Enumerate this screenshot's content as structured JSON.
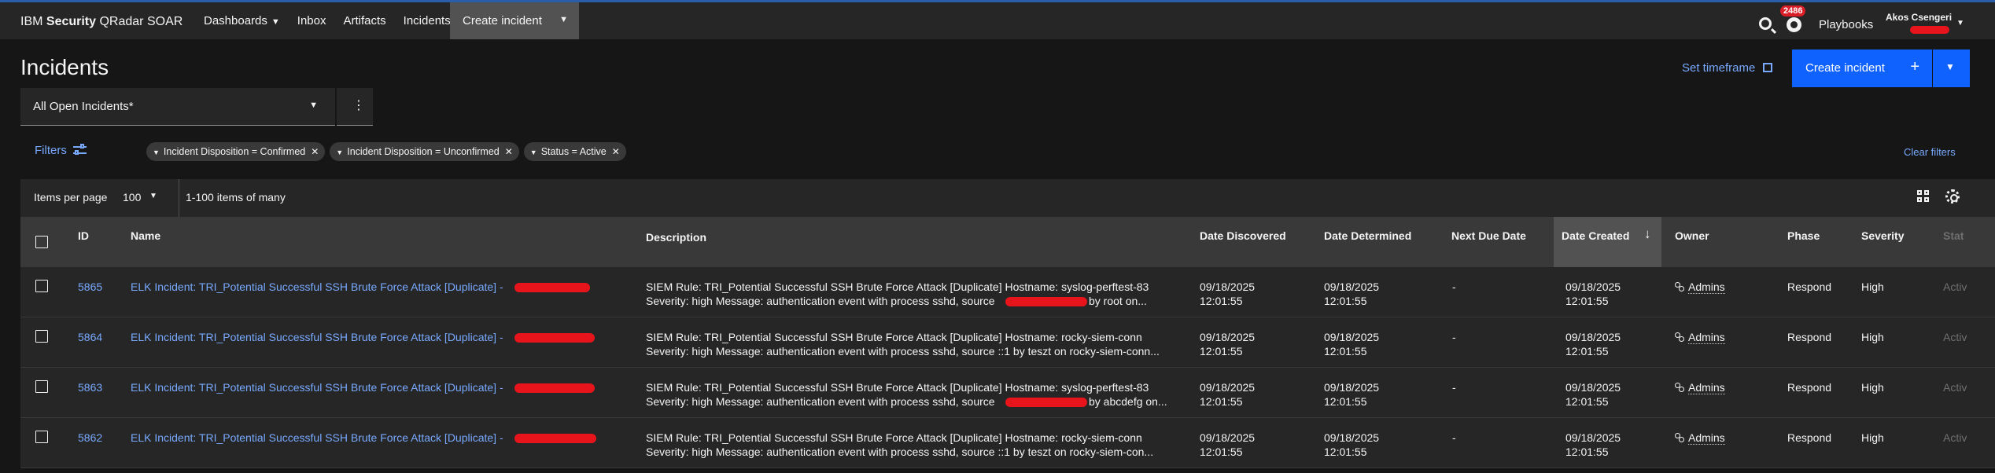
{
  "header": {
    "brand_prefix": "IBM ",
    "brand_bold": "Security",
    "brand_suffix": " QRadar SOAR",
    "nav": [
      "Dashboards",
      "Inbox",
      "Artifacts",
      "Incidents"
    ],
    "create_incident": "Create incident",
    "notification_count": "2486",
    "playbooks": "Playbooks",
    "user_name": "Akos Csengeri"
  },
  "page": {
    "title": "Incidents",
    "set_timeframe": "Set timeframe",
    "create_button": "Create incident"
  },
  "view": {
    "selected": "All Open Incidents*"
  },
  "filters": {
    "label": "Filters",
    "tags": [
      "Incident Disposition = Confirmed",
      "Incident Disposition = Unconfirmed",
      "Status = Active"
    ],
    "clear": "Clear filters"
  },
  "toolbar": {
    "items_per_page_label": "Items per page",
    "items_per_page_value": "100",
    "range": "1-100 items of many"
  },
  "table": {
    "columns": {
      "id": "ID",
      "name": "Name",
      "description": "Description",
      "date_discovered": "Date Discovered",
      "date_determined": "Date Determined",
      "next_due": "Next Due Date",
      "date_created": "Date Created",
      "owner": "Owner",
      "phase": "Phase",
      "severity": "Severity",
      "status": "Stat"
    },
    "rows": [
      {
        "id": "5865",
        "name": "ELK Incident: TRI_Potential Successful SSH Brute Force Attack [Duplicate] -",
        "desc1": "SIEM Rule: TRI_Potential Successful SSH Brute Force Attack [Duplicate] Hostname: syslog-perftest-83",
        "desc2a": "Severity: high Message: authentication event with process sshd, source",
        "desc2b": "by root on...",
        "discovered_date": "09/18/2025",
        "discovered_time": "12:01:55",
        "determined_date": "09/18/2025",
        "determined_time": "12:01:55",
        "next_due": "-",
        "created_date": "09/18/2025",
        "created_time": "12:01:55",
        "owner": "Admins",
        "phase": "Respond",
        "severity": "High",
        "status": "Activ"
      },
      {
        "id": "5864",
        "name": "ELK Incident: TRI_Potential Successful SSH Brute Force Attack [Duplicate] -",
        "desc1": "SIEM Rule: TRI_Potential Successful SSH Brute Force Attack [Duplicate] Hostname: rocky-siem-conn",
        "desc2a": "Severity: high Message: authentication event with process sshd, source ::1 by teszt on rocky-siem-conn...",
        "desc2b": "",
        "discovered_date": "09/18/2025",
        "discovered_time": "12:01:55",
        "determined_date": "09/18/2025",
        "determined_time": "12:01:55",
        "next_due": "-",
        "created_date": "09/18/2025",
        "created_time": "12:01:55",
        "owner": "Admins",
        "phase": "Respond",
        "severity": "High",
        "status": "Activ"
      },
      {
        "id": "5863",
        "name": "ELK Incident: TRI_Potential Successful SSH Brute Force Attack [Duplicate] -",
        "desc1": "SIEM Rule: TRI_Potential Successful SSH Brute Force Attack [Duplicate] Hostname: syslog-perftest-83",
        "desc2a": "Severity: high Message: authentication event with process sshd, source",
        "desc2b": "by abcdefg on...",
        "discovered_date": "09/18/2025",
        "discovered_time": "12:01:55",
        "determined_date": "09/18/2025",
        "determined_time": "12:01:55",
        "next_due": "-",
        "created_date": "09/18/2025",
        "created_time": "12:01:55",
        "owner": "Admins",
        "phase": "Respond",
        "severity": "High",
        "status": "Activ"
      },
      {
        "id": "5862",
        "name": "ELK Incident: TRI_Potential Successful SSH Brute Force Attack [Duplicate] -",
        "desc1": "SIEM Rule: TRI_Potential Successful SSH Brute Force Attack [Duplicate] Hostname: rocky-siem-conn",
        "desc2a": "Severity: high Message: authentication event with process sshd, source ::1 by teszt on rocky-siem-con...",
        "desc2b": "",
        "discovered_date": "09/18/2025",
        "discovered_time": "12:01:55",
        "determined_date": "09/18/2025",
        "determined_time": "12:01:55",
        "next_due": "-",
        "created_date": "09/18/2025",
        "created_time": "12:01:55",
        "owner": "Admins",
        "phase": "Respond",
        "severity": "High",
        "status": "Activ"
      }
    ]
  },
  "icons": {
    "search": "search-icon",
    "notifications": "notification-icon",
    "calendar": "calendar-icon",
    "filter": "filter-settings-icon",
    "grid": "grid-view-icon",
    "settings": "gear-icon",
    "sort": "arrow-down-icon",
    "owner": "user-group-icon"
  },
  "colors": {
    "primary_button": "#0f62fe",
    "link": "#78a9ff",
    "badge": "#da1e28",
    "redaction": "#e8141c",
    "header_accent": "#2a5ea8"
  }
}
